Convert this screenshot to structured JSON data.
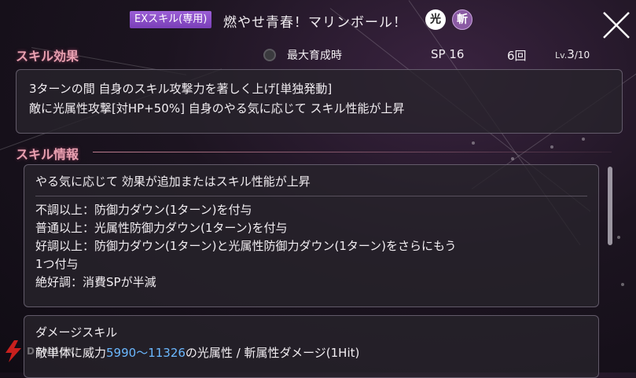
{
  "header": {
    "badge": "EXスキル(専用)",
    "skill_name": "燃やせ青春！マリンボール！",
    "attributes": [
      "光",
      "斬"
    ],
    "close_icon": "close-icon"
  },
  "skill_effect": {
    "title": "スキル効果",
    "max_training_label": "最大育成時",
    "sp": "SP 16",
    "uses": "6回",
    "level_prefix": "Lv.",
    "level": "3",
    "level_max": "/10",
    "lines": [
      "3ターンの間 自身のスキル攻撃力を著しく上げ[単独発動]",
      "敵に光属性攻撃[対HP+50%] 自身のやる気に応じて スキル性能が上昇"
    ]
  },
  "skill_info": {
    "title": "スキル情報",
    "motivation_heading": "やる気に応じて 効果が追加またはスキル性能が上昇",
    "motivation_lines": [
      "不調以上：防御力ダウン(1ターン)を付与",
      "普通以上：光属性防御力ダウン(1ターン)を付与",
      "好調以上：防御力ダウン(1ターン)と光属性防御力ダウン(1ターン)をさらにもう",
      "1つ付与",
      "絶好調：消費SPが半減"
    ],
    "damage_heading": "ダメージスキル",
    "damage_prefix": "敵単体に威力",
    "damage_value": "5990～11326",
    "damage_suffix": "の光属性 / 斬属性ダメージ(1Hit)"
  },
  "watermark": "DENGEKI"
}
